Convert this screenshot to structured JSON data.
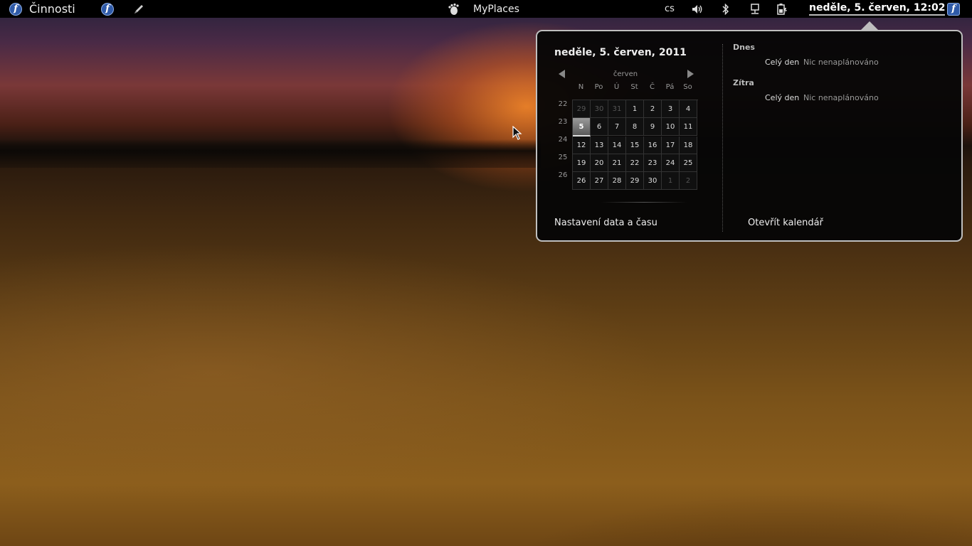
{
  "topbar": {
    "activities": "Činnosti",
    "app_name": "MyPlaces",
    "language": "cs",
    "clock": "neděle,  5. červen, 12:02",
    "icons": [
      "fedora-icon",
      "fedora-launcher-icon",
      "pencil-icon",
      "gnome-foot-icon",
      "volume-icon",
      "bluetooth-icon",
      "network-icon",
      "battery-icon",
      "fedora-user-icon"
    ]
  },
  "calendar": {
    "date_title": "neděle,  5. červen, 2011",
    "month": "červen",
    "weekdays": [
      "N",
      "Po",
      "Ú",
      "St",
      "Č",
      "Pá",
      "So"
    ],
    "week_numbers": [
      "22",
      "23",
      "24",
      "25",
      "26"
    ],
    "weeks": [
      [
        {
          "d": "29",
          "o": true
        },
        {
          "d": "30",
          "o": true
        },
        {
          "d": "31",
          "o": true
        },
        {
          "d": "1"
        },
        {
          "d": "2"
        },
        {
          "d": "3"
        },
        {
          "d": "4"
        }
      ],
      [
        {
          "d": "5",
          "t": true
        },
        {
          "d": "6"
        },
        {
          "d": "7"
        },
        {
          "d": "8"
        },
        {
          "d": "9"
        },
        {
          "d": "10"
        },
        {
          "d": "11"
        }
      ],
      [
        {
          "d": "12"
        },
        {
          "d": "13"
        },
        {
          "d": "14"
        },
        {
          "d": "15"
        },
        {
          "d": "16"
        },
        {
          "d": "17"
        },
        {
          "d": "18"
        }
      ],
      [
        {
          "d": "19"
        },
        {
          "d": "20"
        },
        {
          "d": "21"
        },
        {
          "d": "22"
        },
        {
          "d": "23"
        },
        {
          "d": "24"
        },
        {
          "d": "25"
        }
      ],
      [
        {
          "d": "26"
        },
        {
          "d": "27"
        },
        {
          "d": "28"
        },
        {
          "d": "29"
        },
        {
          "d": "30"
        },
        {
          "d": "1",
          "o": true
        },
        {
          "d": "2",
          "o": true
        }
      ]
    ],
    "settings_link": "Nastavení data a času"
  },
  "events": {
    "today_label": "Dnes",
    "today_time": "Celý den",
    "today_text": "Nic nenaplánováno",
    "tomorrow_label": "Zítra",
    "tomorrow_time": "Celý den",
    "tomorrow_text": "Nic nenaplánováno",
    "open_calendar": "Otevřít kalendář"
  }
}
